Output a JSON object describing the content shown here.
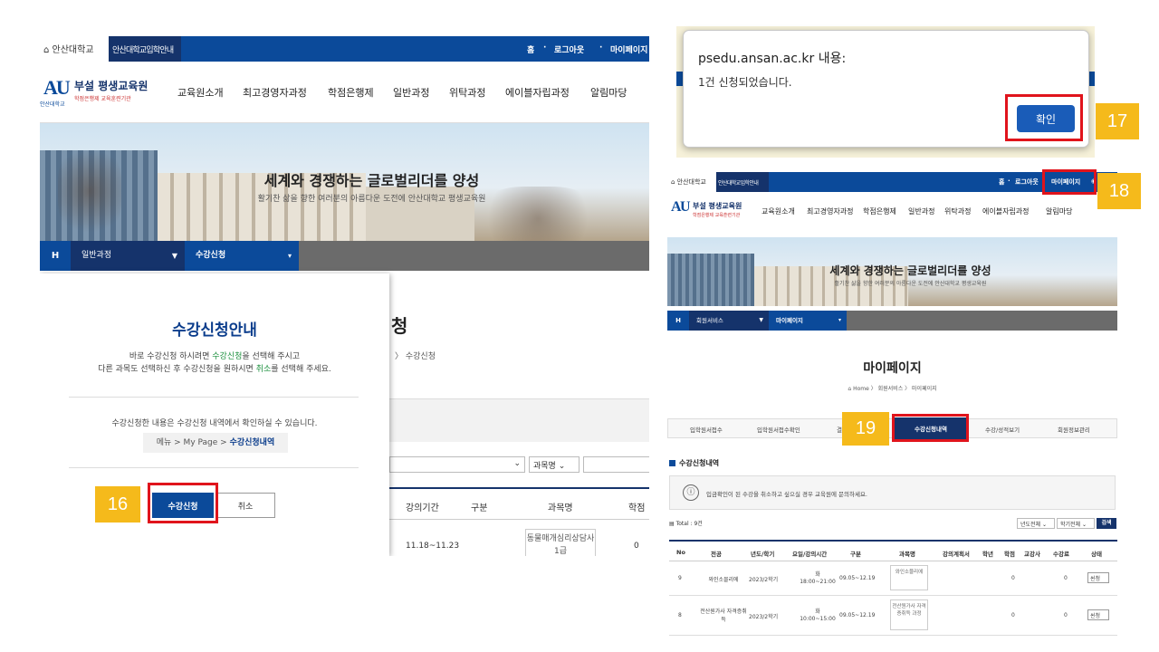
{
  "left": {
    "top_nav": {
      "university": "안산대학교",
      "site_tab": "안산대학교입학안내",
      "links": [
        "홈",
        "로그아웃",
        "마이페이지"
      ]
    },
    "logo": {
      "mark": "AU",
      "mark_sub": "안산대학교",
      "title": "부설 평생교육원",
      "subtitle": "학점은행제 교육훈련기관"
    },
    "menu": [
      "교육원소개",
      "최고경영자과정",
      "학점은행제",
      "일반과정",
      "위탁과정",
      "에이블자립과정",
      "알림마당"
    ],
    "hero": {
      "title": "세계와 경쟁하는 글로벌리더를 양성",
      "subtitle": "활기찬 삶을 향한 여러분의 아름다운 도전에 안산대학교 평생교육원"
    },
    "location": {
      "home": "H",
      "depth1": "일반과정",
      "depth2": "수강신청"
    },
    "content": {
      "title_partial": "청",
      "breadcrumb": "수강신청",
      "select_course": "과목명",
      "columns": [
        "강의기간",
        "구분",
        "과목명",
        "학점"
      ],
      "row": {
        "period": "11.18~11.23",
        "course": "동물매개심리상담사1급",
        "credit": "0"
      }
    },
    "modal": {
      "title": "수강신청안내",
      "line1_a": "바로 수강신청 하시려면 ",
      "line1_hl": "수강신청",
      "line1_b": "을 선택해 주시고",
      "line2_a": "다른 과목도 선택하신 후 수강신청을 원하시면 ",
      "line2_hl": "취소",
      "line2_b": "를 선택해 주세요.",
      "line3": "수강신청한 내용은 수강신청 내역에서 확인하실 수 있습니다.",
      "path_prefix": "메뉴 > My Page > ",
      "path_bold": "수강신청내역",
      "apply_button": "수강신청",
      "cancel_button": "취소"
    },
    "step": "16"
  },
  "alert": {
    "origin": "psedu.ansan.ac.kr 내용:",
    "message": "1건 신청되었습니다.",
    "ok_button": "확인",
    "step": "17"
  },
  "right": {
    "top_nav": {
      "university": "안산대학교",
      "site_tab": "안산대학교입학안내",
      "links": [
        "홈",
        "로그아웃",
        "마이페이지"
      ]
    },
    "logo": {
      "mark": "AU",
      "title": "부설 평생교육원",
      "subtitle": "학점은행제 교육훈련기관"
    },
    "menu": [
      "교육원소개",
      "최고경영자과정",
      "학점은행제",
      "일반과정",
      "위탁과정",
      "에이블자립과정",
      "알림마당"
    ],
    "hero": {
      "title": "세계와 경쟁하는 글로벌리더를 양성",
      "subtitle": "활기찬 삶을 향한 여러분의 아름다운 도전에 안산대학교 평생교육원"
    },
    "location": {
      "home": "H",
      "depth1": "회원서비스",
      "depth2": "마이페이지"
    },
    "page_title": "마이페이지",
    "breadcrumb": "Home  〉 회원서비스  〉 마이페이지",
    "tabs": [
      "입학원서접수",
      "입학원서접수확인",
      "결",
      "수강신청내역",
      "수강/성적보기",
      "회원정보관리"
    ],
    "section_title": "수강신청내역",
    "notice": "입금확인이 된 수강을 취소하고 싶으실 경우 교육원에 문의하세요.",
    "total": "Total : 9건",
    "filters": {
      "year": "년도전체",
      "term": "학기전체",
      "search": "검색"
    },
    "columns": [
      "No",
      "전공",
      "년도/학기",
      "요일/강의시간",
      "구분",
      "과목명",
      "강의계획서",
      "학년",
      "학점",
      "교강사",
      "수강료",
      "상태"
    ],
    "rows": [
      {
        "no": "9",
        "major": "와인소믈리에",
        "term": "2023/2학기",
        "day": "화",
        "time": "18:00~21:00",
        "period": "09.05~12.19",
        "course": "와인소믈리에",
        "credit": "0",
        "fee": "0",
        "status": "신청"
      },
      {
        "no": "8",
        "major": "전산원가사 자격증취득",
        "term": "2023/2학기",
        "day": "화",
        "time": "10:00~15:00",
        "period": "09.05~12.19",
        "course": "전산원가사 자격증취득 과정",
        "credit": "0",
        "fee": "0",
        "status": "신청"
      }
    ],
    "step18": "18",
    "step19": "19"
  }
}
